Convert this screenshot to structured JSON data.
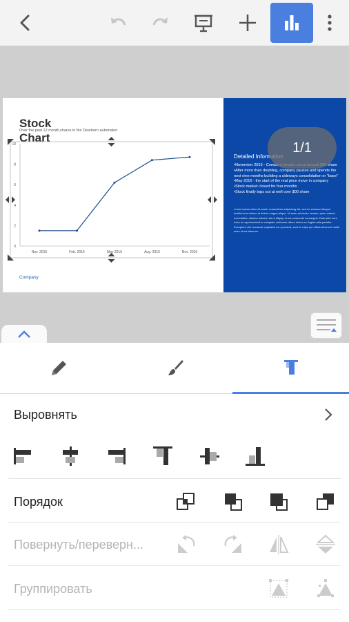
{
  "toolbar": {
    "icons": [
      "back-arrow-icon",
      "undo-icon",
      "redo-icon",
      "presentation-icon",
      "add-icon",
      "chart-bar-icon",
      "more-vert-icon"
    ],
    "accent": "#4a7fe0"
  },
  "slide": {
    "title_line1": "Stock",
    "title_line2": "Chart",
    "subtitle": "Over the past 12 month,shares in the Dearborn automaker",
    "company": "Company",
    "right_bg": "#0b48a8",
    "detail_title": "Detailed Information",
    "detail_items": [
      "•November 2015 - Company breaks out at around $00 share",
      "•After more than doubling, company pauses and spends the next nine months building a sideways consolidation or \"base\"",
      "•May 2016 - the start of the real price move in company",
      "•Stock market closed for four months",
      "•Stock finally tops out at well over $00 share"
    ],
    "lorem": "Lorem ipsum dolor sit amet, consectetur adipiscing elit, sed do eiusmod tempor incididunt ut labore et dolore magna aliqua. Ut enim ad minim veniam, quis nostrud exercitation ullamco laboris nisi ut aliquip ex ea commodo consequat. Duis aute irure dolor in reprehenderit in voluptate velit esse cillum dolore eu fugiat nulla pariatur. Excepteur sint occaecat cupidatat non proident, sunt in culpa qui officia deserunt mollit anim id est laborum."
  },
  "page_indicator": "1/1",
  "chart_data": {
    "type": "line",
    "categories": [
      "Nov. 2015",
      "Feb. 2016",
      "May 2016",
      "Aug. 2016",
      "Nov. 2016"
    ],
    "x": [
      "Nov. 2015",
      "Feb. 2016",
      "May 2016",
      "Aug. 2016",
      "Nov. 2016"
    ],
    "values": [
      1.5,
      1.5,
      6.2,
      8.4,
      8.7
    ],
    "ylim": [
      0,
      10
    ],
    "yticks": [
      "0",
      "2",
      "4",
      "6",
      "8",
      "10"
    ],
    "grid": false,
    "color": "#1f4e8c"
  },
  "tabs": [
    {
      "icon": "pencil-icon"
    },
    {
      "icon": "brush-icon"
    },
    {
      "icon": "align-top-icon",
      "active": true
    }
  ],
  "panel": {
    "align_label": "Выровнять",
    "order_label": "Порядок",
    "rotate_label": "Повернуть/переверн...",
    "group_label": "Группировать"
  }
}
